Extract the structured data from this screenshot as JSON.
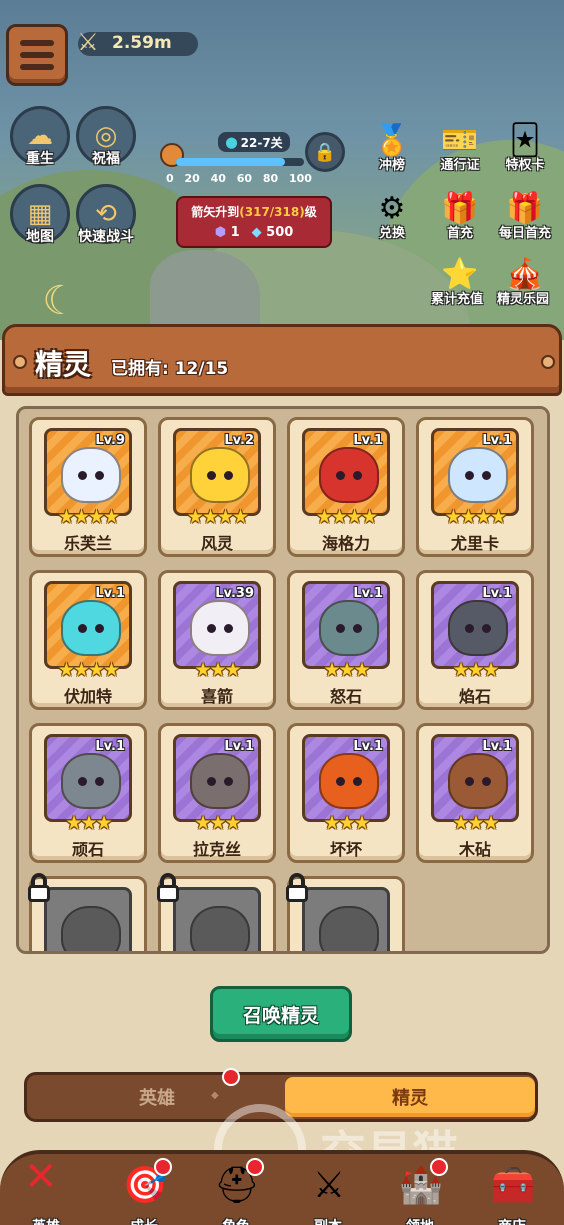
{
  "top_bar": {
    "power": "2.59m"
  },
  "left_buttons": [
    {
      "label": "重生",
      "icon": "angel-icon"
    },
    {
      "label": "祝福",
      "icon": "goggles-icon"
    },
    {
      "label": "地图",
      "icon": "map-icon"
    },
    {
      "label": "快速战斗",
      "icon": "fast-battle-icon"
    }
  ],
  "stage": {
    "label": "22-7关",
    "progress_ticks": [
      "0",
      "20",
      "40",
      "60",
      "80",
      "100"
    ],
    "progress_fraction": 0.85
  },
  "reward": {
    "prefix": "箭矢升到",
    "highlight": "(317/318)",
    "suffix": "级",
    "item1": "1",
    "item2": "500"
  },
  "right_buttons": [
    {
      "label": "冲榜",
      "icon": "rank-icon"
    },
    {
      "label": "通行证",
      "icon": "pass-icon"
    },
    {
      "label": "特权卡",
      "icon": "privilege-card-icon"
    },
    {
      "label": "兑换",
      "icon": "exchange-icon"
    },
    {
      "label": "首充",
      "icon": "first-charge-icon"
    },
    {
      "label": "每日首充",
      "icon": "daily-charge-icon"
    },
    {
      "label": "累计充值",
      "icon": "total-charge-icon"
    },
    {
      "label": "精灵乐园",
      "icon": "sprite-park-icon"
    }
  ],
  "panel": {
    "title": "精灵",
    "owned_label": "已拥有: 12/15"
  },
  "sprites": [
    {
      "name": "乐芙兰",
      "level": "Lv.9",
      "stars": "★★★★",
      "frame": "orange",
      "color": "#eaf2ff"
    },
    {
      "name": "风灵",
      "level": "Lv.2",
      "stars": "★★★★",
      "frame": "orange",
      "color": "#ffd23a"
    },
    {
      "name": "海格力",
      "level": "Lv.1",
      "stars": "★★★★",
      "frame": "orange",
      "color": "#d8342e"
    },
    {
      "name": "尤里卡",
      "level": "Lv.1",
      "stars": "★★★★",
      "frame": "orange",
      "color": "#cfe6ff"
    },
    {
      "name": "伏加特",
      "level": "Lv.1",
      "stars": "★★★★",
      "frame": "orange",
      "color": "#4fd8e0"
    },
    {
      "name": "喜箭",
      "level": "Lv.39",
      "stars": "★★★",
      "frame": "purple",
      "color": "#f2eef6"
    },
    {
      "name": "怒石",
      "level": "Lv.1",
      "stars": "★★★",
      "frame": "purple",
      "color": "#6a8a8e"
    },
    {
      "name": "焰石",
      "level": "Lv.1",
      "stars": "★★★",
      "frame": "purple",
      "color": "#555a66"
    },
    {
      "name": "顽石",
      "level": "Lv.1",
      "stars": "★★★",
      "frame": "purple",
      "color": "#7d8790"
    },
    {
      "name": "拉克丝",
      "level": "Lv.1",
      "stars": "★★★",
      "frame": "purple",
      "color": "#7a6e6e"
    },
    {
      "name": "坏坏",
      "level": "Lv.1",
      "stars": "★★★",
      "frame": "purple",
      "color": "#e8601e"
    },
    {
      "name": "木砧",
      "level": "Lv.1",
      "stars": "★★★",
      "frame": "purple",
      "color": "#9a5a36"
    }
  ],
  "locked_sprites": 3,
  "summon_button": "召唤精灵",
  "toggle": {
    "left": "英雄",
    "right": "精灵"
  },
  "watermark": "交易猫",
  "bottom_nav": [
    {
      "label": "英雄",
      "icon": "close-icon"
    },
    {
      "label": "成长",
      "icon": "scarecrow-icon"
    },
    {
      "label": "角色",
      "icon": "knight-helmet-icon"
    },
    {
      "label": "副本",
      "icon": "crossed-swords-icon"
    },
    {
      "label": "领地",
      "icon": "castle-icon"
    },
    {
      "label": "商店",
      "icon": "treasure-chest-icon"
    }
  ]
}
